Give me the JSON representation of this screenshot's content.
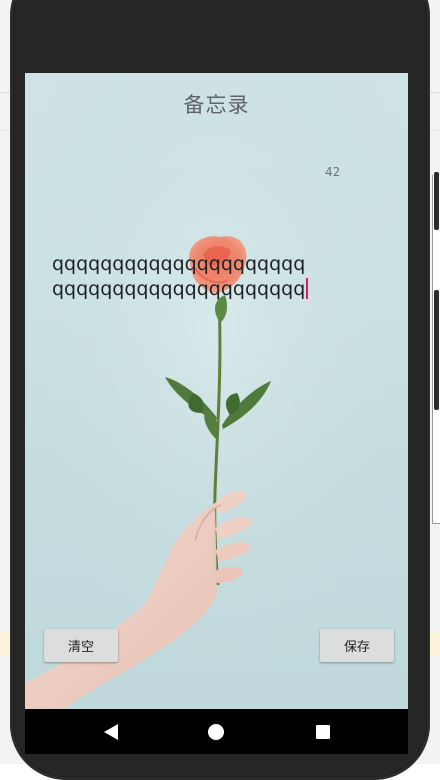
{
  "app": {
    "title": "备忘录",
    "char_count": "42"
  },
  "editor": {
    "text": "qqqqqqqqqqqqqqqqqqqqqqqqqqqqqqqqqqqqqqqqqq"
  },
  "buttons": {
    "clear_label": "清空",
    "save_label": "保存"
  },
  "colors": {
    "accent_caret": "#d81b60",
    "screen_background": "#cde2e4"
  },
  "icons": {
    "back": "back-triangle-icon",
    "home": "home-circle-icon",
    "recents": "recents-square-icon"
  }
}
